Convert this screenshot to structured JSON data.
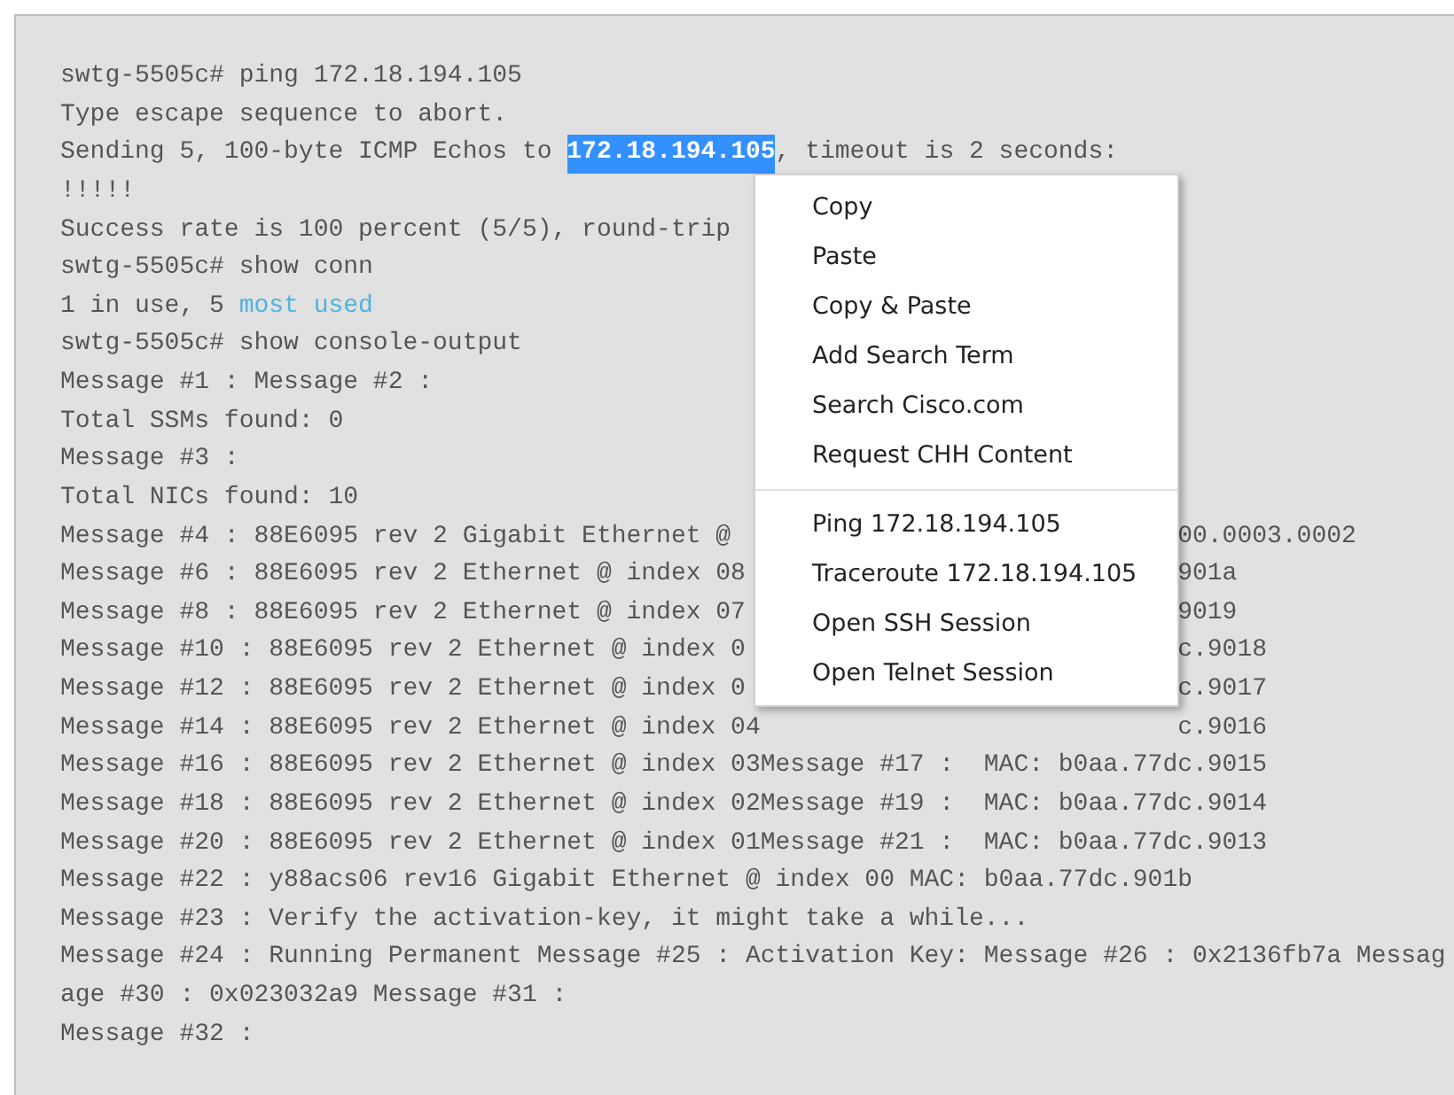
{
  "terminal": {
    "lines": [
      {
        "segments": [
          {
            "kind": "plain",
            "text": "swtg-5505c# ping 172.18.194.105"
          }
        ]
      },
      {
        "segments": [
          {
            "kind": "plain",
            "text": "Type escape sequence to abort."
          }
        ]
      },
      {
        "segments": [
          {
            "kind": "plain",
            "text": "Sending 5, 100-byte ICMP Echos to "
          },
          {
            "kind": "selected",
            "text": "172.18.194.105"
          },
          {
            "kind": "plain",
            "text": ", timeout is 2 seconds:"
          }
        ]
      },
      {
        "segments": [
          {
            "kind": "plain",
            "text": "!!!!!"
          }
        ]
      },
      {
        "segments": [
          {
            "kind": "plain",
            "text": "Success rate is 100 percent (5/5), round-trip"
          }
        ]
      },
      {
        "segments": [
          {
            "kind": "plain",
            "text": "swtg-5505c# show conn"
          }
        ]
      },
      {
        "segments": [
          {
            "kind": "plain",
            "text": "1 in use, 5 "
          },
          {
            "kind": "link",
            "text": "most used"
          }
        ]
      },
      {
        "segments": [
          {
            "kind": "plain",
            "text": "swtg-5505c# show console-output"
          }
        ]
      },
      {
        "segments": [
          {
            "kind": "plain",
            "text": "Message #1 : Message #2 :"
          }
        ]
      },
      {
        "segments": [
          {
            "kind": "plain",
            "text": "Total SSMs found: 0"
          }
        ]
      },
      {
        "segments": [
          {
            "kind": "plain",
            "text": "Message #3 :"
          }
        ]
      },
      {
        "segments": [
          {
            "kind": "plain",
            "text": "Total NICs found: 10"
          }
        ]
      },
      {
        "segments": [
          {
            "kind": "plain",
            "text": "Message #4 : 88E6095 rev 2 Gigabit Ethernet @"
          }
        ],
        "tail": "00.0003.0002"
      },
      {
        "segments": [
          {
            "kind": "plain",
            "text": "Message #6 : 88E6095 rev 2 Ethernet @ index 08"
          }
        ],
        "tail": "901a"
      },
      {
        "segments": [
          {
            "kind": "plain",
            "text": "Message #8 : 88E6095 rev 2 Ethernet @ index 07"
          }
        ],
        "tail": "9019"
      },
      {
        "segments": [
          {
            "kind": "plain",
            "text": "Message #10 : 88E6095 rev 2 Ethernet @ index 0"
          }
        ],
        "tail": "c.9018"
      },
      {
        "segments": [
          {
            "kind": "plain",
            "text": "Message #12 : 88E6095 rev 2 Ethernet @ index 0"
          }
        ],
        "tail": "c.9017"
      },
      {
        "segments": [
          {
            "kind": "plain",
            "text": "Message #14 : 88E6095 rev 2 Ethernet @ index 04"
          }
        ],
        "tail": "c.9016"
      },
      {
        "segments": [
          {
            "kind": "plain",
            "text": "Message #16 : 88E6095 rev 2 Ethernet @ index 03Message #17 :  MAC: b0aa.77dc.9015"
          }
        ]
      },
      {
        "segments": [
          {
            "kind": "plain",
            "text": "Message #18 : 88E6095 rev 2 Ethernet @ index 02Message #19 :  MAC: b0aa.77dc.9014"
          }
        ]
      },
      {
        "segments": [
          {
            "kind": "plain",
            "text": "Message #20 : 88E6095 rev 2 Ethernet @ index 01Message #21 :  MAC: b0aa.77dc.9013"
          }
        ]
      },
      {
        "segments": [
          {
            "kind": "plain",
            "text": "Message #22 : y88acs06 rev16 Gigabit Ethernet @ index 00 MAC: b0aa.77dc.901b"
          }
        ]
      },
      {
        "segments": [
          {
            "kind": "plain",
            "text": "Message #23 : Verify the activation-key, it might take a while..."
          }
        ]
      },
      {
        "segments": [
          {
            "kind": "plain",
            "text": "Message #24 : Running Permanent Message #25 : Activation Key: Message #26 : 0x2136fb7a Messag"
          }
        ]
      },
      {
        "segments": [
          {
            "kind": "plain",
            "text": "age #30 : 0x023032a9 Message #31 :"
          }
        ]
      },
      {
        "segments": [
          {
            "kind": "plain",
            "text": "Message #32 :"
          }
        ]
      }
    ]
  },
  "context_menu": {
    "groups": [
      [
        "Copy",
        "Paste",
        "Copy & Paste",
        "Add Search Term",
        "Search Cisco.com",
        "Request CHH Content"
      ],
      [
        "Ping 172.18.194.105",
        "Traceroute 172.18.194.105",
        "Open SSH Session",
        "Open Telnet Session"
      ]
    ]
  }
}
